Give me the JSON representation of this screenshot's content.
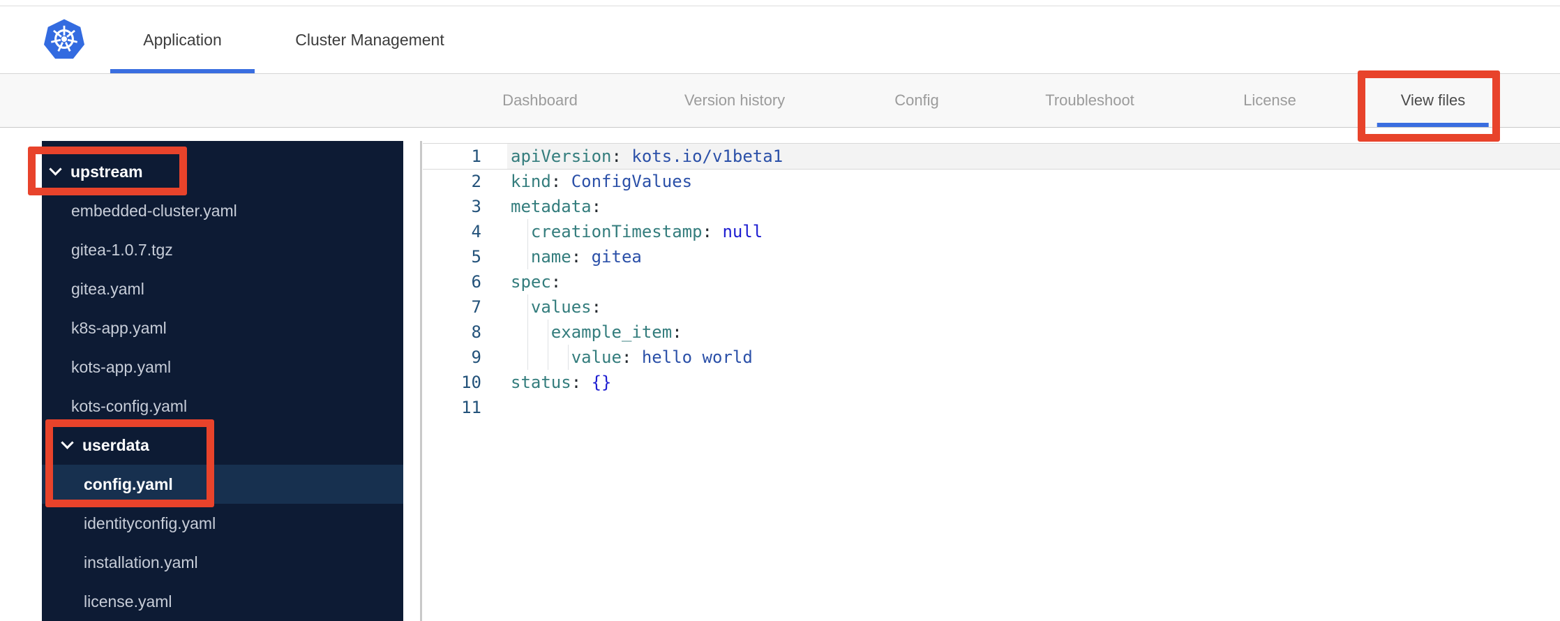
{
  "colors": {
    "accent-blue": "#3a6ee0",
    "annotation-red": "#e8432b",
    "sidebar-bg": "#0d1b34",
    "sidebar-selected": "#17304f",
    "logo-blue": "#336be0",
    "syntax-key": "#347d7d",
    "syntax-value": "#2b50a8",
    "syntax-keyword": "#1d1dd1",
    "syntax-punct": "#24292e",
    "lineno": "#23527a"
  },
  "header": {
    "logo_icon": "kubernetes-logo",
    "tabs": [
      {
        "label": "Application",
        "active": true
      },
      {
        "label": "Cluster Management",
        "active": false
      }
    ]
  },
  "subnav": {
    "items": [
      {
        "label": "Dashboard",
        "active": false
      },
      {
        "label": "Version history",
        "active": false
      },
      {
        "label": "Config",
        "active": false
      },
      {
        "label": "Troubleshoot",
        "active": false
      },
      {
        "label": "License",
        "active": false
      },
      {
        "label": "View files",
        "active": true,
        "annotated": true
      }
    ]
  },
  "file_tree": {
    "items": [
      {
        "label": "upstream",
        "type": "folder",
        "level": 1,
        "expanded": true,
        "icon": "chevron-down-icon",
        "annotated": true
      },
      {
        "label": "embedded-cluster.yaml",
        "type": "file",
        "level": 1
      },
      {
        "label": "gitea-1.0.7.tgz",
        "type": "file",
        "level": 1
      },
      {
        "label": "gitea.yaml",
        "type": "file",
        "level": 1
      },
      {
        "label": "k8s-app.yaml",
        "type": "file",
        "level": 1
      },
      {
        "label": "kots-app.yaml",
        "type": "file",
        "level": 1
      },
      {
        "label": "kots-config.yaml",
        "type": "file",
        "level": 1
      },
      {
        "label": "userdata",
        "type": "folder",
        "level": 2,
        "expanded": true,
        "icon": "chevron-down-icon",
        "annotated": true
      },
      {
        "label": "config.yaml",
        "type": "file",
        "level": 2,
        "selected": true,
        "annotated": true
      },
      {
        "label": "identityconfig.yaml",
        "type": "file",
        "level": 2
      },
      {
        "label": "installation.yaml",
        "type": "file",
        "level": 2
      },
      {
        "label": "license.yaml",
        "type": "file",
        "level": 2
      }
    ]
  },
  "editor": {
    "language": "yaml",
    "active_line": 1,
    "lines": [
      {
        "no": "1",
        "indent": 0,
        "active": true,
        "tokens": [
          {
            "c": "key",
            "t": "apiVersion"
          },
          {
            "c": "punct",
            "t": ":"
          },
          {
            "c": "plain",
            "t": " "
          },
          {
            "c": "val",
            "t": "kots.io/v1beta1"
          }
        ]
      },
      {
        "no": "2",
        "indent": 0,
        "tokens": [
          {
            "c": "key",
            "t": "kind"
          },
          {
            "c": "punct",
            "t": ":"
          },
          {
            "c": "plain",
            "t": " "
          },
          {
            "c": "val",
            "t": "ConfigValues"
          }
        ]
      },
      {
        "no": "3",
        "indent": 0,
        "tokens": [
          {
            "c": "key",
            "t": "metadata"
          },
          {
            "c": "punct",
            "t": ":"
          }
        ]
      },
      {
        "no": "4",
        "indent": 2,
        "tokens": [
          {
            "c": "key",
            "t": "creationTimestamp"
          },
          {
            "c": "punct",
            "t": ":"
          },
          {
            "c": "plain",
            "t": " "
          },
          {
            "c": "kw",
            "t": "null"
          }
        ]
      },
      {
        "no": "5",
        "indent": 2,
        "tokens": [
          {
            "c": "key",
            "t": "name"
          },
          {
            "c": "punct",
            "t": ":"
          },
          {
            "c": "plain",
            "t": " "
          },
          {
            "c": "val",
            "t": "gitea"
          }
        ]
      },
      {
        "no": "6",
        "indent": 0,
        "tokens": [
          {
            "c": "key",
            "t": "spec"
          },
          {
            "c": "punct",
            "t": ":"
          }
        ]
      },
      {
        "no": "7",
        "indent": 2,
        "tokens": [
          {
            "c": "key",
            "t": "values"
          },
          {
            "c": "punct",
            "t": ":"
          }
        ]
      },
      {
        "no": "8",
        "indent": 4,
        "tokens": [
          {
            "c": "key",
            "t": "example_item"
          },
          {
            "c": "punct",
            "t": ":"
          }
        ]
      },
      {
        "no": "9",
        "indent": 6,
        "tokens": [
          {
            "c": "key",
            "t": "value"
          },
          {
            "c": "punct",
            "t": ":"
          },
          {
            "c": "plain",
            "t": " "
          },
          {
            "c": "val",
            "t": "hello world"
          }
        ]
      },
      {
        "no": "10",
        "indent": 0,
        "tokens": [
          {
            "c": "key",
            "t": "status"
          },
          {
            "c": "punct",
            "t": ":"
          },
          {
            "c": "plain",
            "t": " "
          },
          {
            "c": "kw",
            "t": "{}"
          }
        ]
      },
      {
        "no": "11",
        "indent": 0,
        "tokens": []
      }
    ]
  },
  "annotations": [
    {
      "target": "view-files-tab"
    },
    {
      "target": "upstream-folder"
    },
    {
      "target": "userdata-folder-and-config-yaml"
    }
  ]
}
